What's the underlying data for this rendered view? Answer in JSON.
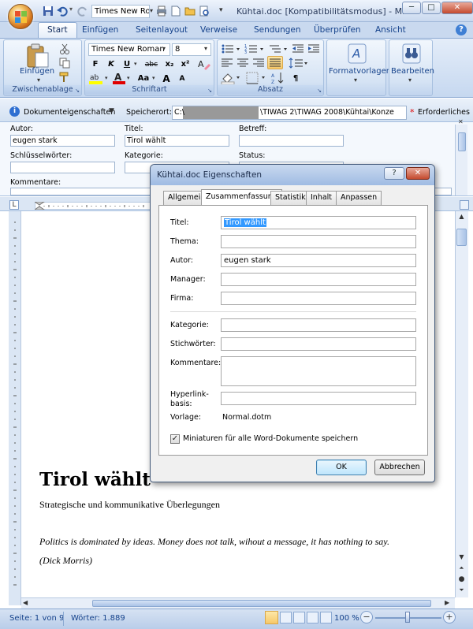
{
  "window": {
    "title": "Kühtai.doc [Kompatibilitätsmodus] - Mic...",
    "minimize": "─",
    "maximize": "□",
    "close": "✕"
  },
  "qat": {
    "font_name": "Times New Ro"
  },
  "tabs": [
    "Start",
    "Einfügen",
    "Seitenlayout",
    "Verweise",
    "Sendungen",
    "Überprüfen",
    "Ansicht"
  ],
  "ribbon": {
    "clipboard": {
      "paste_label": "Einfügen",
      "group_label": "Zwischenablage"
    },
    "font": {
      "font_name": "Times New Roman",
      "font_size": "8",
      "bold": "F",
      "italic": "K",
      "underline": "U",
      "strike": "abc",
      "sub": "x₂",
      "sup": "x²",
      "case": "Aa",
      "grow": "A",
      "shrink": "A",
      "group_label": "Schriftart"
    },
    "paragraph": {
      "group_label": "Absatz",
      "pilcrow": "¶"
    },
    "styles": {
      "label": "Formatvorlagen",
      "icon_text": "A"
    },
    "editing": {
      "label": "Bearbeiten"
    }
  },
  "doc_panel": {
    "title": "Dokumenteigenschaften",
    "location_label": "Speicherort:",
    "location_value_start": "C:\\",
    "location_value_end": "\\TIWAG 2\\TIWAG 2008\\Kühtai\\Konze",
    "required": "Erforderliches",
    "required_star": "*",
    "fields": {
      "autor_label": "Autor:",
      "autor_value": "eugen stark",
      "titel_label": "Titel:",
      "titel_value": "Tirol wählt",
      "betreff_label": "Betreff:",
      "betreff_value": "",
      "schluessel_label": "Schlüsselwörter:",
      "kategorie_label": "Kategorie:",
      "status_label": "Status:",
      "kommentare_label": "Kommentare:"
    }
  },
  "document": {
    "heading": "Tirol wählt",
    "subheading": "Strategische und kommunikative Überlegungen",
    "quote": "Politics is dominated by ideas. Money does not talk, wihout a message, it has nothing to say.",
    "attribution": "(Dick Morris)"
  },
  "status": {
    "page": "Seite: 1 von 9",
    "words": "Wörter: 1.889",
    "zoom": "100 %",
    "zoom_minus": "−",
    "zoom_plus": "+"
  },
  "dialog": {
    "title": "Kühtai.doc Eigenschaften",
    "help": "?",
    "close": "✕",
    "tabs": [
      "Allgemein",
      "Zusammenfassung",
      "Statistik",
      "Inhalt",
      "Anpassen"
    ],
    "active_tab": "Zusammenfassung",
    "fields": {
      "titel_label": "Titel:",
      "titel_value": "Tirol wählt",
      "thema_label": "Thema:",
      "thema_value": "",
      "autor_label": "Autor:",
      "autor_value": "eugen stark",
      "manager_label": "Manager:",
      "manager_value": "",
      "firma_label": "Firma:",
      "firma_value": "",
      "kategorie_label": "Kategorie:",
      "kategorie_value": "",
      "stichwoerter_label": "Stichwörter:",
      "stichwoerter_value": "",
      "kommentare_label": "Kommentare:",
      "kommentare_value": "",
      "hyperlink_label_1": "Hyperlink-",
      "hyperlink_label_2": "basis:",
      "hyperlink_value": "",
      "vorlage_label": "Vorlage:",
      "vorlage_value": "Normal.dotm"
    },
    "checkbox_label": "Miniaturen für alle Word-Dokumente speichern",
    "checkbox_checked": true,
    "ok": "OK",
    "cancel": "Abbrechen"
  }
}
